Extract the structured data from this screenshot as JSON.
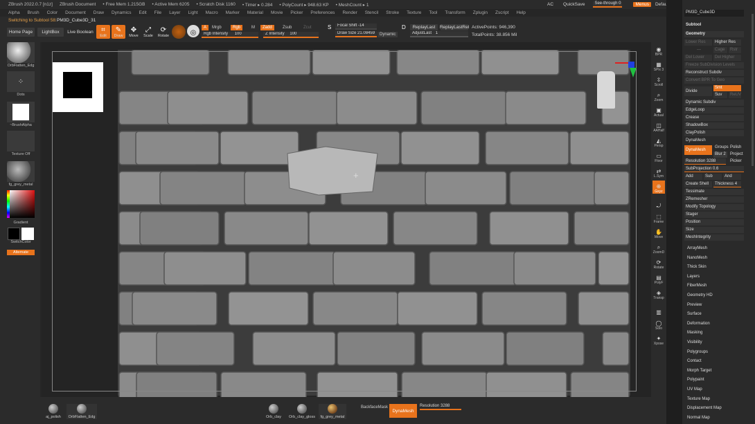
{
  "titlebar": {
    "app_title": "ZBrush 2022.0.7 [n1z]",
    "document": "ZBrush Document",
    "free_mem": "• Free Mem 1.215GB",
    "active_mem": "• Active Mem 6205",
    "scratch_disk": "• Scratch Disk 1160",
    "timer": "• Timer ▸ 0.284",
    "polycount": "• PolyCount ▸ 948.63 KP",
    "meshcount": "• MeshCount ▸ 1",
    "ac_label": "AC",
    "quicksave": "QuickSave",
    "see_through_label": "See-through",
    "see_through_value": "0",
    "menus_label": "Menus",
    "script_label": "DefaultZScript"
  },
  "menu": [
    "Alpha",
    "Brush",
    "Color",
    "Document",
    "Draw",
    "Dynamics",
    "Edit",
    "File",
    "Layer",
    "Light",
    "Macro",
    "Marker",
    "Material",
    "Movie",
    "Picker",
    "Preferences",
    "Render",
    "Stencil",
    "Stroke",
    "Texture",
    "Tool",
    "Transform",
    "Zplugin",
    "Zscript",
    "Help"
  ],
  "shelf": {
    "status_text": "Switching to Subtool 58:",
    "status_value": "PM3D_Cube3D_31",
    "home_page": "Home Page",
    "lightbox": "LightBox",
    "live_boolean": "Live Boolean",
    "edit": "Edit",
    "draw": "Draw",
    "move": "Move",
    "scale": "Scale",
    "rotate": "Rotate",
    "a_label": "A",
    "mrgb": "Mrgb",
    "rgb": "Rgb",
    "m": "M",
    "rgb_intensity_label": "Rgb Intensity",
    "rgb_intensity_value": "100",
    "zadd": "Zadd",
    "zsub": "Zsub",
    "zcut": "Zcut",
    "z_intensity_label": "Z Intensity",
    "z_intensity_value": "100",
    "focal_shift_label": "Focal Shift",
    "focal_shift_value": "-14",
    "draw_size_label": "Draw Size",
    "draw_size_value": "21.08459",
    "dynamic": "Dynamic",
    "replay_last": "ReplayLast",
    "replay_last_rel": "ReplayLastRel",
    "adjust_last_label": "AdjustLast",
    "adjust_last_value": "1",
    "active_points": "ActivePoints: 946,390",
    "total_points": "TotalPoints: 38.856 Mil"
  },
  "left_tray": {
    "brush_name": "OrbFlatten_Edg",
    "stroke_name": "Dots",
    "alpha_name": "~BrushAlpha",
    "texture_name": "Texture Off",
    "material_name": "fg_grey_metal",
    "gradient_label": "Gradient",
    "switchcolor_label": "SwitchColor",
    "alternate_label": "Alternate"
  },
  "right_tray": [
    "BPR",
    "SPix 3",
    "Scroll",
    "Zoom",
    "Actual",
    "AAHalf",
    "Persp",
    "Floor",
    "L.Sym",
    "Gxyz",
    "",
    "Frame",
    "Move",
    "ZoomD",
    "Rotate",
    "PolyF",
    "Transp",
    "",
    "Solo",
    "Xpose"
  ],
  "tool_panel": {
    "tool_name": "PM3D_Cube3D",
    "subtool": "Subtool",
    "geometry": "Geometry",
    "lower_res": "Lower Res",
    "higher_res": "Higher Res",
    "cage": "Cage",
    "rstr": "Rstr",
    "del_lower": "Del Lower",
    "del_higher": "Del Higher",
    "freeze_subdiv": "Freeze SubDivision Levels",
    "reconstruct_subdiv": "Reconstruct Subdiv",
    "convert_bpr": "Convert BPR To Geo",
    "divide": "Divide",
    "smt": "Smt",
    "suv": "Suv",
    "reuv": "ReUV",
    "dynamic_subdiv": "Dynamic Subdiv",
    "edgeloop": "EdgeLoop",
    "crease": "Crease",
    "shadowbox": "ShadowBox",
    "claypolish": "ClayPolish",
    "dynamesh_section": "DynaMesh",
    "dynamesh_btn": "DynaMesh",
    "groups": "Groups",
    "polish": "Polish",
    "blur_label": "Blur",
    "blur_value": "2",
    "project": "Project",
    "resolution_label": "Resolution",
    "resolution_value": "3288",
    "picker": "Picker",
    "subprojection_label": "SubProjection",
    "subprojection_value": "0.6",
    "add": "Add",
    "sub": "Sub",
    "and": "And",
    "create_shell": "Create Shell",
    "thickness_label": "Thickness",
    "thickness_value": "4",
    "tessimate": "Tessimate",
    "zremesher": "ZRemesher",
    "modify_topology": "Modify Topology",
    "stager": "Stager",
    "position": "Position",
    "size": "Size",
    "meshintegrity": "MeshIntegrity",
    "sections": [
      "ArrayMesh",
      "NanoMesh",
      "Thick Skin",
      "Layers",
      "FiberMesh",
      "Geometry HD",
      "Preview",
      "Surface",
      "Deformation",
      "Masking",
      "Visibility",
      "Polygroups",
      "Contact",
      "Morph Target",
      "Polypaint",
      "UV Map",
      "Texture Map",
      "Displacement Map",
      "Normal Map"
    ]
  },
  "bottom_shelf": {
    "items_left": [
      "aj_polish",
      "OrbFlatten_Edg"
    ],
    "items_mid": [
      "Orb_clay",
      "Orb_clay_gloss",
      "fg_grey_metal"
    ],
    "backface_mask": "BackfaceMask",
    "dynamesh": "DynaMesh",
    "resolution_label": "Resolution",
    "resolution_value": "3288"
  },
  "colors": {
    "accent": "#e8731c",
    "panel_bg": "#2a2a2a",
    "canvas_bg": "#242424",
    "stone": "#8a8a8a",
    "mortar": "#3c3c3c"
  }
}
